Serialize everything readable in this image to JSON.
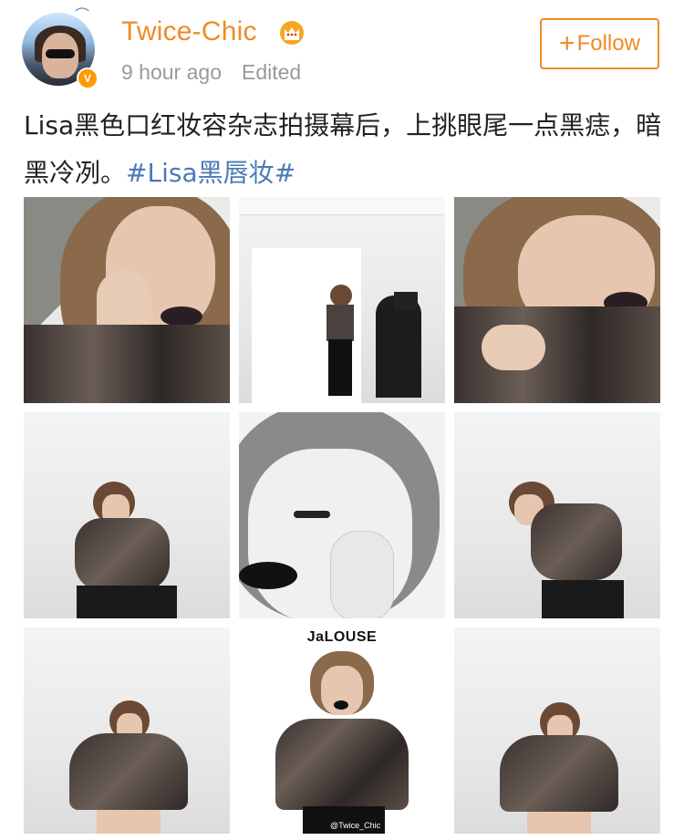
{
  "user": {
    "name": "Twice-Chic",
    "verified_badge": "V",
    "time": "9 hour ago",
    "edited_label": "Edited"
  },
  "follow_button": {
    "plus": "+",
    "label": "Follow"
  },
  "post": {
    "text": "Lisa黑色口红妆容杂志拍摄幕后，上挑眼尾一点黑痣，暗黑冷冽。",
    "hashtag": "#Lisa黑唇妆#"
  },
  "photos": [
    {
      "name": "photo-closeup-hand-face"
    },
    {
      "name": "photo-studio-behind-scenes"
    },
    {
      "name": "photo-closeup-tilted"
    },
    {
      "name": "photo-crouch-pose"
    },
    {
      "name": "photo-bw-closeup"
    },
    {
      "name": "photo-crouch-pose-2"
    },
    {
      "name": "photo-hands-on-head"
    },
    {
      "name": "photo-magazine-cover"
    },
    {
      "name": "photo-hands-on-head-2"
    }
  ],
  "magazine_logo": "JaLOUSE",
  "watermark_text": "@Twice_Chic",
  "colors": {
    "accent": "#f08a24",
    "hashtag": "#4a7ab8",
    "meta": "#9a9a9a"
  },
  "icons": {
    "crown": "crown-icon",
    "verified": "verified-badge-icon",
    "bird": "bird-icon"
  }
}
